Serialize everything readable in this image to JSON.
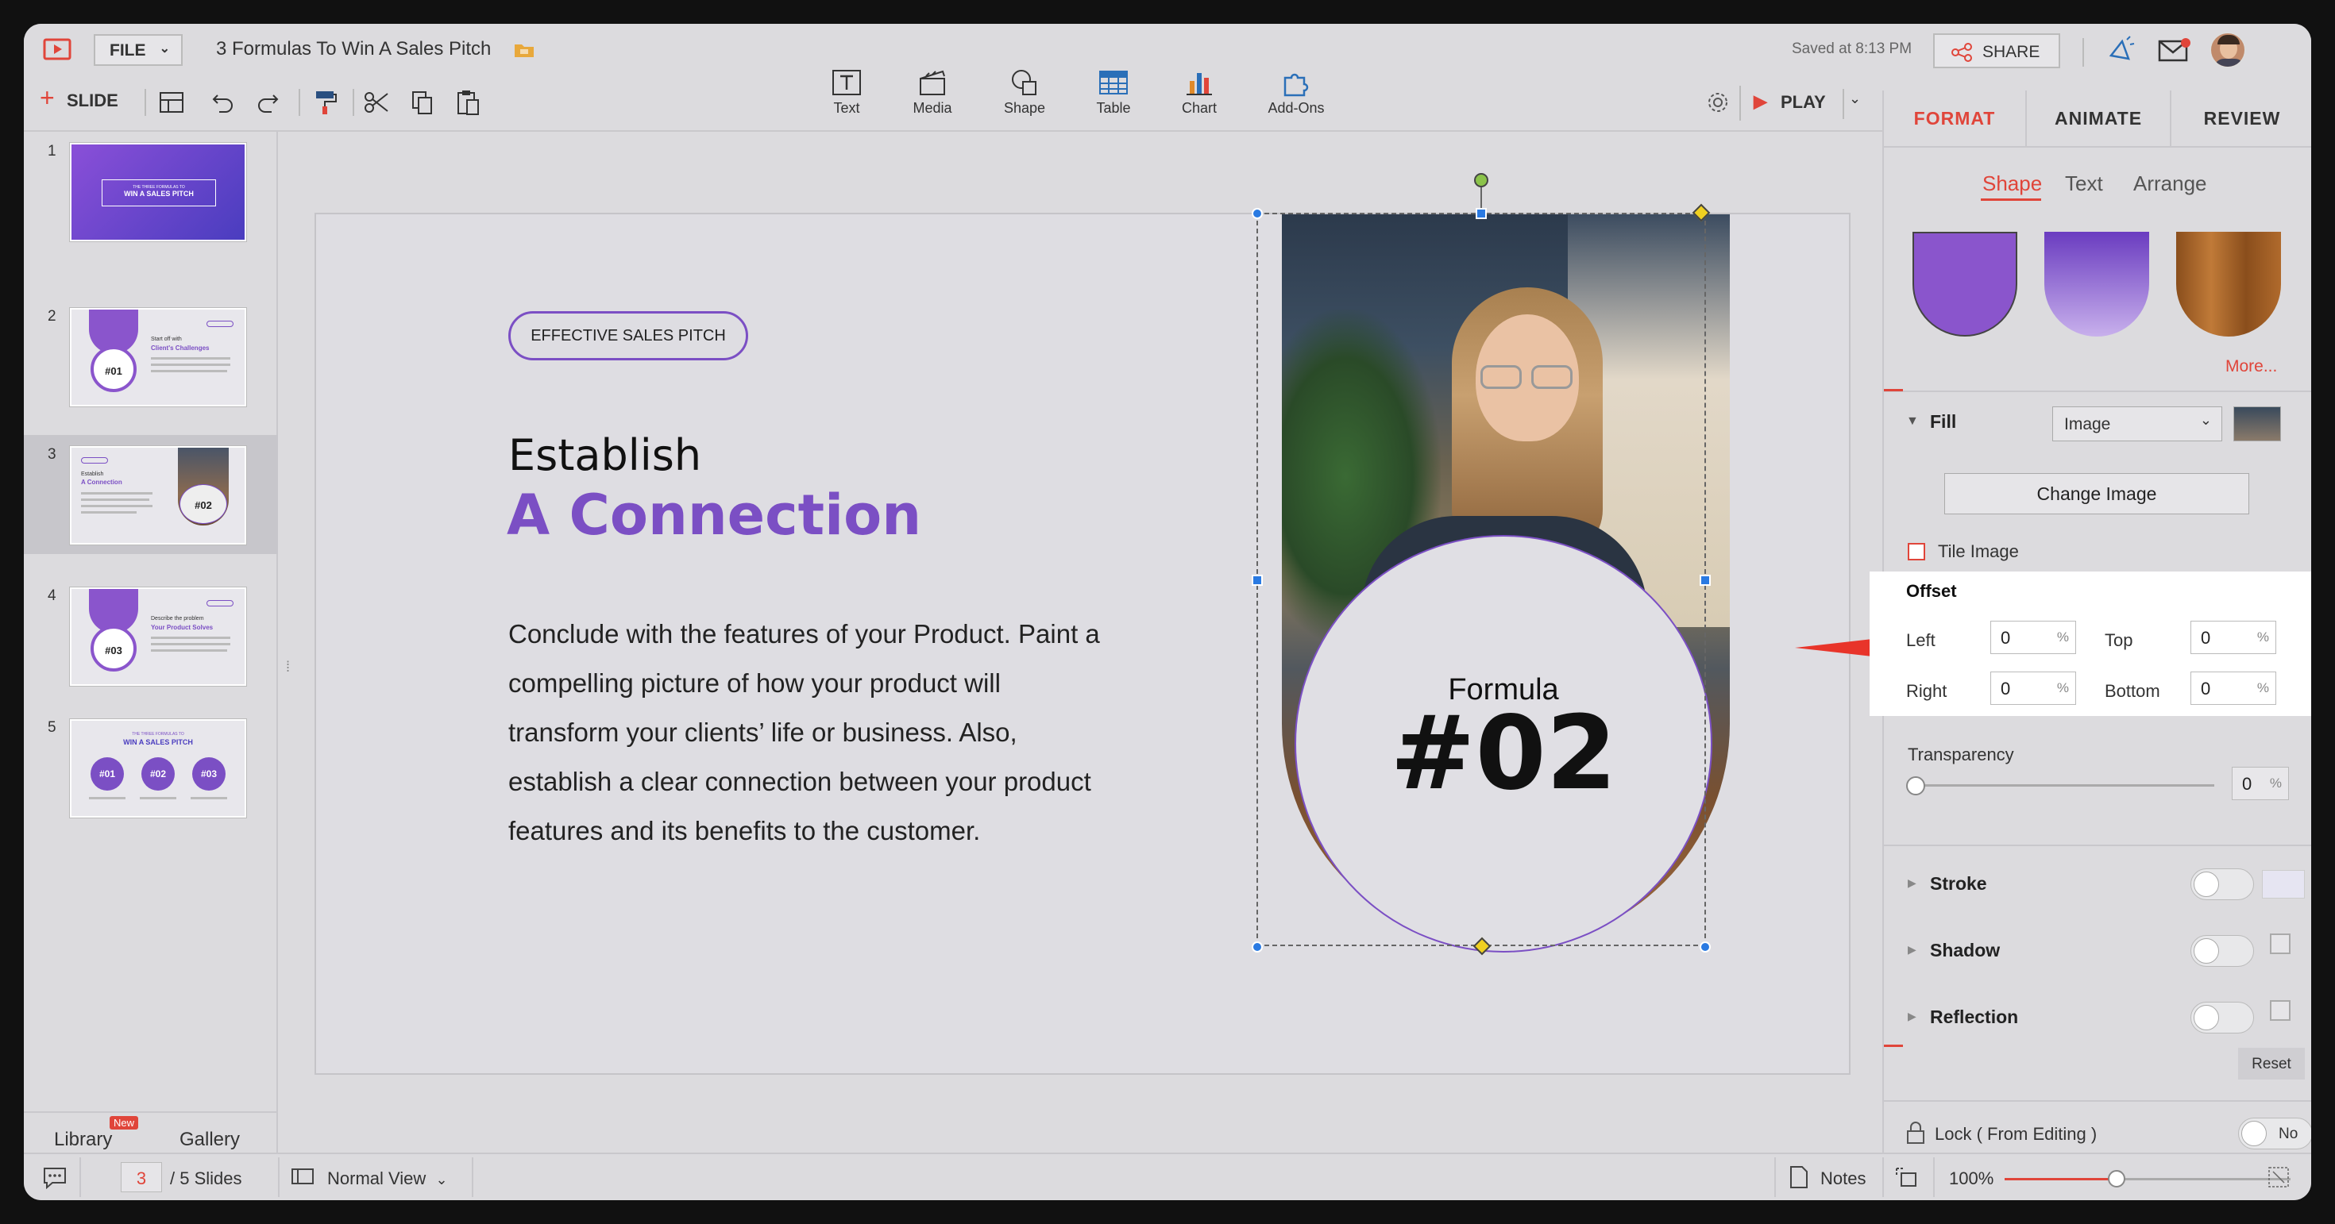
{
  "app": {
    "file_menu": "FILE",
    "doc_title": "3 Formulas To Win A Sales Pitch",
    "saved_status": "Saved at 8:13 PM",
    "share_label": "SHARE",
    "slide_button": "SLIDE",
    "play_label": "PLAY"
  },
  "insert_toolbar": {
    "text": "Text",
    "media": "Media",
    "shape": "Shape",
    "table": "Table",
    "chart": "Chart",
    "addons": "Add-Ons"
  },
  "slides_panel": {
    "numbers": [
      "1",
      "2",
      "3",
      "4",
      "5"
    ],
    "library_label": "Library",
    "new_badge": "New",
    "gallery_label": "Gallery",
    "thumb1": {
      "sub": "THE THREE FORMULAS TO",
      "title": "WIN A SALES PITCH"
    },
    "thumb2": {
      "num": "#01",
      "line1": "Start off with",
      "line2": "Client's Challenges"
    },
    "thumb3": {
      "num": "#02",
      "line1": "Establish",
      "line2": "A Connection"
    },
    "thumb4": {
      "num": "#03",
      "line1": "Describe the problem",
      "line2": "Your Product Solves"
    },
    "thumb5": {
      "sub": "THE THREE FORMULAS TO",
      "title": "WIN A SALES PITCH",
      "n1": "#01",
      "n2": "#02",
      "n3": "#03"
    }
  },
  "slide": {
    "pill": "EFFECTIVE SALES PITCH",
    "heading1": "Establish",
    "heading2": "A Connection",
    "body_lines": [
      "Conclude with the features of your Product. Paint a",
      "compelling picture of how your product will",
      "transform your clients’ life or business. Also,",
      "establish a clear connection between your product",
      "features and its benefits to the customer."
    ],
    "formula_label": "Formula",
    "formula_number": "#02"
  },
  "format_panel": {
    "tabs": [
      "FORMAT",
      "ANIMATE",
      "REVIEW"
    ],
    "subtabs": [
      "Shape",
      "Text",
      "Arrange"
    ],
    "more": "More...",
    "fill_label": "Fill",
    "fill_type": "Image",
    "change_image": "Change Image",
    "tile_image": "Tile Image",
    "offset_title": "Offset",
    "left_label": "Left",
    "left_value": "0",
    "top_label": "Top",
    "top_value": "0",
    "right_label": "Right",
    "right_value": "0",
    "bottom_label": "Bottom",
    "bottom_value": "0",
    "pct": "%",
    "transparency_label": "Transparency",
    "transparency_value": "0",
    "stroke_label": "Stroke",
    "shadow_label": "Shadow",
    "reflection_label": "Reflection",
    "reset_label": "Reset",
    "lock_label": "Lock ( From Editing )",
    "lock_value": "No"
  },
  "statusbar": {
    "current_slide": "3",
    "total_slides": "/ 5 Slides",
    "view_mode": "Normal View",
    "notes": "Notes",
    "zoom": "100%"
  },
  "colors": {
    "accent_red": "#e0453a",
    "brand_purple": "#7b4fc4",
    "selection_blue": "#2a7ae2"
  }
}
